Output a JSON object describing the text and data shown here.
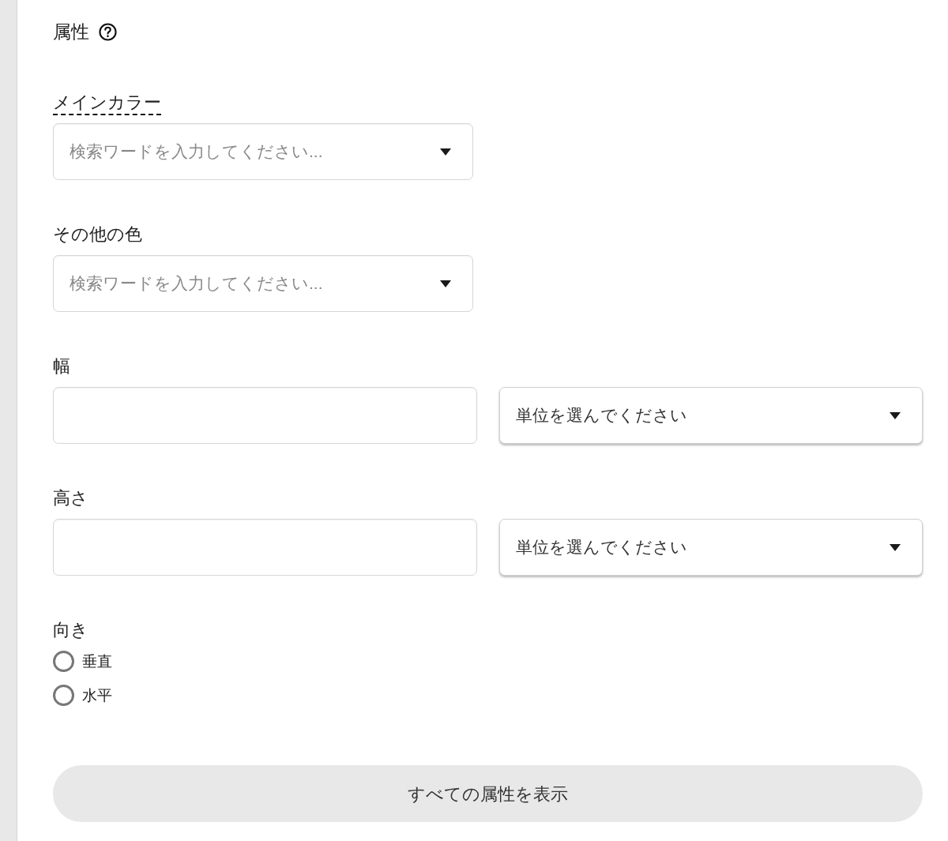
{
  "header": {
    "title": "属性"
  },
  "fields": [
    {
      "kind": "search_select",
      "label": "メインカラー",
      "hint": true,
      "placeholder": "検索ワードを入力してください..."
    },
    {
      "kind": "search_select",
      "label": "その他の色",
      "hint": false,
      "placeholder": "検索ワードを入力してください..."
    },
    {
      "kind": "measure",
      "label": "幅",
      "hint": false,
      "unit_text": "単位を選んでください"
    },
    {
      "kind": "measure",
      "label": "高さ",
      "hint": false,
      "unit_text": "単位を選んでください"
    },
    {
      "kind": "radio_group",
      "label": "向き",
      "hint": false,
      "options": [
        {
          "label": "垂直",
          "selected": false
        },
        {
          "label": "水平",
          "selected": false
        }
      ]
    }
  ],
  "show_all_button": "すべての属性を表示"
}
